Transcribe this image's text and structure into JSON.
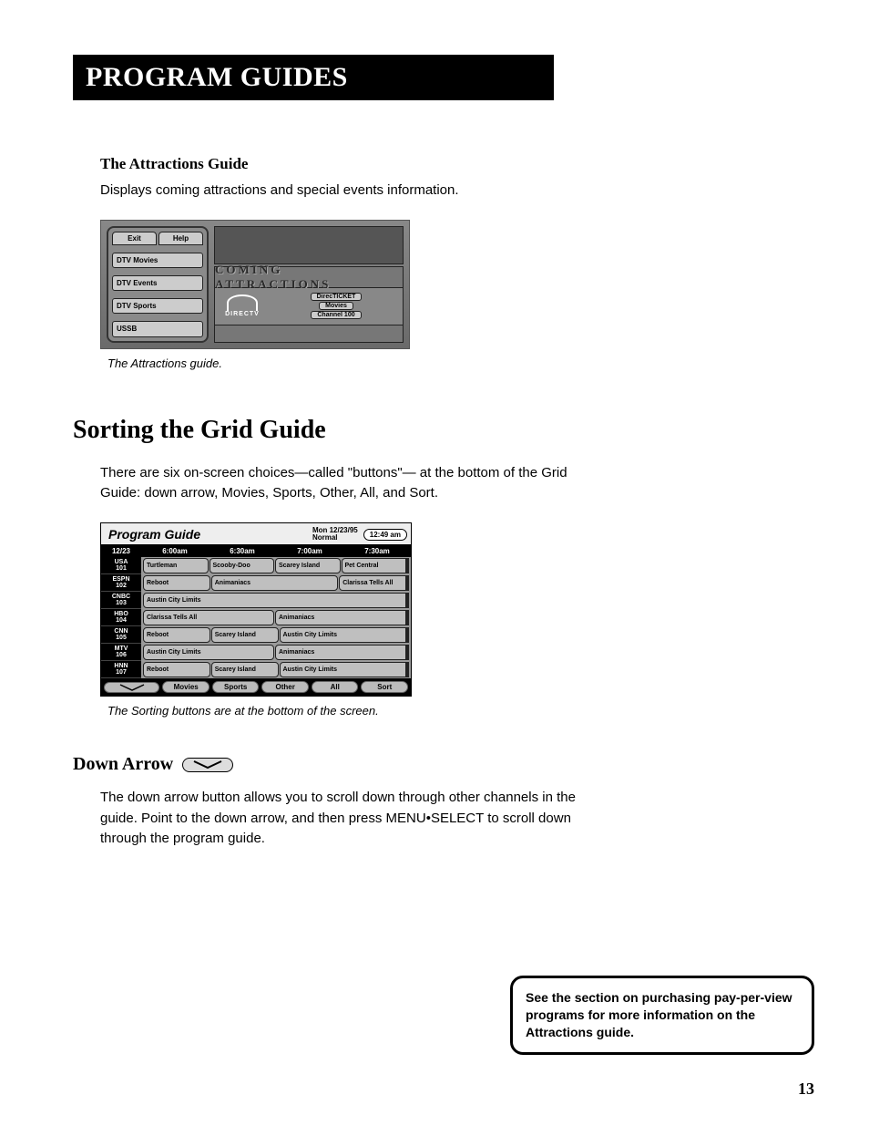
{
  "header": "PROGRAM GUIDES",
  "attractions": {
    "heading": "The Attractions Guide",
    "body": "Displays coming attractions and special events information.",
    "caption": "The Attractions guide.",
    "left_tabs": [
      "Exit",
      "Help"
    ],
    "left_buttons": [
      "DTV Movies",
      "DTV Events",
      "DTV Sports",
      "USSB"
    ],
    "banner": "COMING ATTRACTIONS",
    "logo_text": "DIRECTV",
    "chips": [
      "DirecTICKET",
      "Movies",
      "Channel 100"
    ]
  },
  "sorting": {
    "heading": "Sorting the Grid Guide",
    "body": "There are six on-screen choices—called \"buttons\"— at the bottom of the Grid Guide: down arrow, Movies, Sports, Other, All, and Sort.",
    "caption": "The Sorting buttons are at the bottom of the screen."
  },
  "grid": {
    "title": "Program Guide",
    "date_label": "Mon 12/23/95",
    "mode_label": "Normal",
    "clock": "12:49 am",
    "time_header": {
      "date": "12/23",
      "cols": [
        "6:00am",
        "6:30am",
        "7:00am",
        "7:30am"
      ]
    },
    "rows": [
      {
        "ch_name": "USA",
        "ch_num": "101",
        "progs": [
          {
            "t": "Turtleman",
            "w": 1
          },
          {
            "t": "Scooby-Doo",
            "w": 1
          },
          {
            "t": "Scarey Island",
            "w": 1
          },
          {
            "t": "Pet Central",
            "w": 1,
            "cont": true
          }
        ]
      },
      {
        "ch_name": "ESPN",
        "ch_num": "102",
        "progs": [
          {
            "t": "Reboot",
            "w": 1
          },
          {
            "t": "Animaniacs",
            "w": 2
          },
          {
            "t": "Clarissa Tells All",
            "w": 1,
            "cont": true
          }
        ]
      },
      {
        "ch_name": "CNBC",
        "ch_num": "103",
        "progs": [
          {
            "t": "Austin City Limits",
            "w": 4,
            "cont": true
          }
        ]
      },
      {
        "ch_name": "HBO",
        "ch_num": "104",
        "progs": [
          {
            "t": "Clarissa Tells All",
            "w": 2
          },
          {
            "t": "Animaniacs",
            "w": 2,
            "cont": true
          }
        ]
      },
      {
        "ch_name": "CNN",
        "ch_num": "105",
        "progs": [
          {
            "t": "Reboot",
            "w": 1
          },
          {
            "t": "Scarey Island",
            "w": 1
          },
          {
            "t": "Austin City Limits",
            "w": 2,
            "cont": true
          }
        ]
      },
      {
        "ch_name": "MTV",
        "ch_num": "106",
        "progs": [
          {
            "t": "Austin City Limits",
            "w": 2
          },
          {
            "t": "Animaniacs",
            "w": 2,
            "cont": true
          }
        ]
      },
      {
        "ch_name": "HNN",
        "ch_num": "107",
        "progs": [
          {
            "t": "Reboot",
            "w": 1
          },
          {
            "t": "Scarey Island",
            "w": 1
          },
          {
            "t": "Austin City Limits",
            "w": 2,
            "cont": true
          }
        ]
      }
    ],
    "footer_buttons": [
      "Movies",
      "Sports",
      "Other",
      "All",
      "Sort"
    ]
  },
  "down_arrow": {
    "heading": "Down Arrow",
    "body": "The down arrow button allows you to scroll down through other channels in the guide. Point to the down arrow, and then press MENU•SELECT to scroll down through the program guide."
  },
  "callout": "See the section on purchasing pay-per-view programs for more information on the Attractions guide.",
  "page_number": "13"
}
